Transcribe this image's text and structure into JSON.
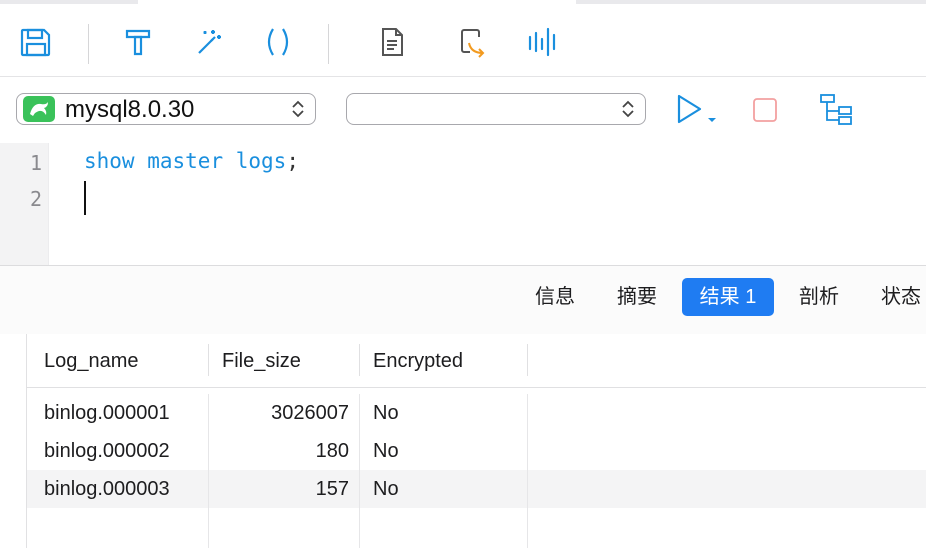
{
  "toolbar": {
    "icons": [
      "save-icon",
      "hammer-icon",
      "magic-wand-icon",
      "parentheses-icon",
      "document-icon",
      "export-icon",
      "waveform-icon"
    ]
  },
  "connection": {
    "database_label": "mysql8.0.30",
    "schema_label": ""
  },
  "editor": {
    "line_numbers": [
      "1",
      "2"
    ],
    "line1": {
      "kw1": "show",
      "kw2": "master",
      "kw3": "logs",
      "punct": ";"
    }
  },
  "result_tabs": [
    {
      "label": "信息",
      "active": false
    },
    {
      "label": "摘要",
      "active": false
    },
    {
      "label": "结果 1",
      "active": true
    },
    {
      "label": "剖析",
      "active": false
    },
    {
      "label": "状态",
      "active": false
    }
  ],
  "table": {
    "columns": [
      "Log_name",
      "File_size",
      "Encrypted"
    ],
    "rows": [
      [
        "binlog.000001",
        "3026007",
        "No"
      ],
      [
        "binlog.000002",
        "180",
        "No"
      ],
      [
        "binlog.000003",
        "157",
        "No"
      ]
    ]
  },
  "colors": {
    "accent": "#1f7cf2",
    "keyword": "#1a8fde",
    "icon_blue": "#1a8fde",
    "icon_orange": "#f29a1f",
    "stop_red": "#f3a0a0",
    "logo_green": "#3ac25a"
  }
}
